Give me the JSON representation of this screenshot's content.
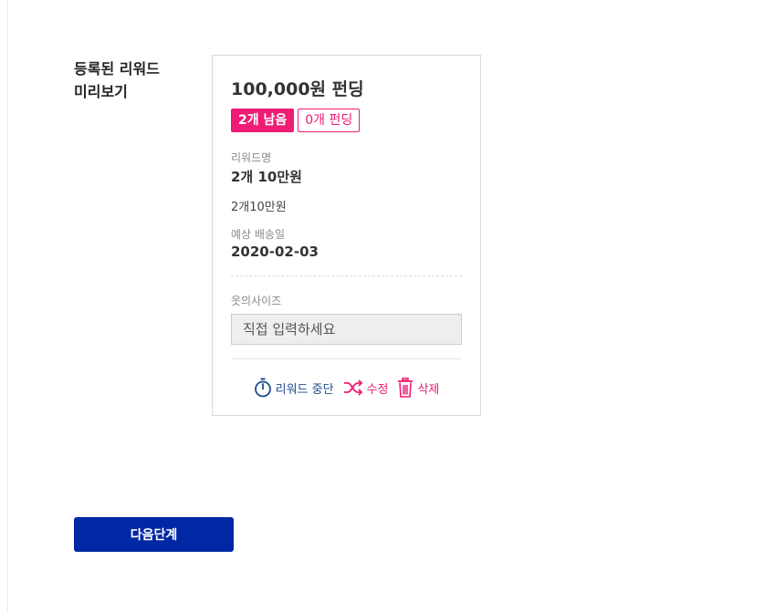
{
  "section": {
    "title_line1": "등록된 리워드",
    "title_line2": "미리보기"
  },
  "reward_card": {
    "price": "100,000원 펀딩",
    "remaining_badge": "2개 남음",
    "funded_badge": "0개 펀딩",
    "reward_name_label": "리워드명",
    "reward_name": "2개 10만원",
    "reward_description": "2개10만원",
    "delivery_label": "예상 배송일",
    "delivery_date": "2020-02-03",
    "option_label": "옷의사이즈",
    "option_placeholder": "직접 입력하세요",
    "actions": {
      "stop_label": "리워드 중단",
      "edit_label": "수정",
      "delete_label": "삭제"
    }
  },
  "footer": {
    "next_button_label": "다음단계"
  },
  "colors": {
    "accent_pink": "#ef1c74",
    "primary_blue": "#0027a4",
    "stop_blue": "#1f4b8f"
  },
  "icons": {
    "stop": "stopwatch-icon",
    "edit": "shuffle-icon",
    "delete": "trash-icon"
  }
}
